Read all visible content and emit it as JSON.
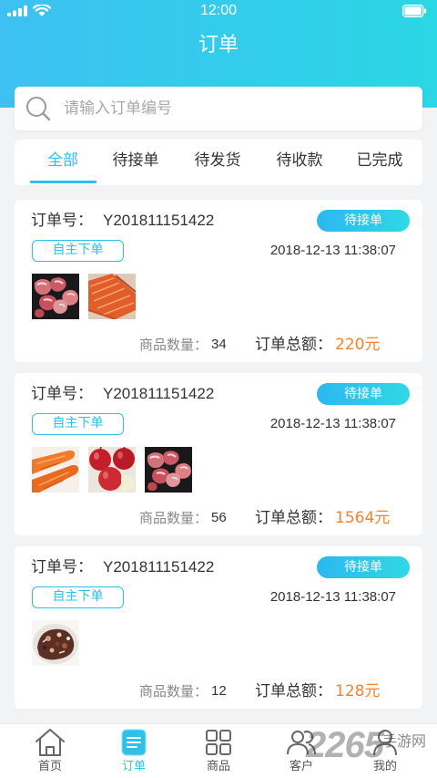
{
  "status_bar": {
    "time": "12:00",
    "icons": [
      "signal-icon",
      "wifi-icon",
      "battery-icon"
    ]
  },
  "header": {
    "title": "订单"
  },
  "search": {
    "placeholder": "请输入订单编号",
    "icon": "search-icon"
  },
  "tabs": [
    {
      "label": "全部",
      "active": true
    },
    {
      "label": "待接单"
    },
    {
      "label": "待发货"
    },
    {
      "label": "待收款"
    },
    {
      "label": "已完成"
    }
  ],
  "orders": [
    {
      "order_no_label": "订单号：",
      "order_no": "Y201811151422",
      "status": "待接单",
      "source_tag": "自主下单",
      "datetime": "2018-12-13 11:38:07",
      "thumbnails": [
        "pork-image",
        "salmon-image"
      ],
      "quantity_label": "商品数量：",
      "quantity": "34",
      "total_label": "订单总额：",
      "total": "220元"
    },
    {
      "order_no_label": "订单号：",
      "order_no": "Y201811151422",
      "status": "待接单",
      "source_tag": "自主下单",
      "datetime": "2018-12-13 11:38:07",
      "thumbnails": [
        "carrot-image",
        "apple-image",
        "pork-image"
      ],
      "quantity_label": "商品数量：",
      "quantity": "56",
      "total_label": "订单总额：",
      "total": "1564元"
    },
    {
      "order_no_label": "订单号：",
      "order_no": "Y201811151422",
      "status": "待接单",
      "source_tag": "自主下单",
      "datetime": "2018-12-13 11:38:07",
      "thumbnails": [
        "dish-image"
      ],
      "quantity_label": "商品数量：",
      "quantity": "12",
      "total_label": "订单总额：",
      "total": "128元"
    }
  ],
  "bottom_nav": [
    {
      "label": "首页",
      "icon": "home-icon"
    },
    {
      "label": "订单",
      "icon": "order-list-icon",
      "active": true
    },
    {
      "label": "商品",
      "icon": "grid-icon"
    },
    {
      "label": "客户",
      "icon": "customers-icon"
    },
    {
      "label": "我的",
      "icon": "profile-icon"
    }
  ],
  "watermark": {
    "number": "2265",
    "text": "手游网"
  },
  "colors": {
    "accent": "#2ec0ea",
    "price": "#f5832b",
    "header_start": "#3dc1f2",
    "header_end": "#2bd6e5"
  }
}
